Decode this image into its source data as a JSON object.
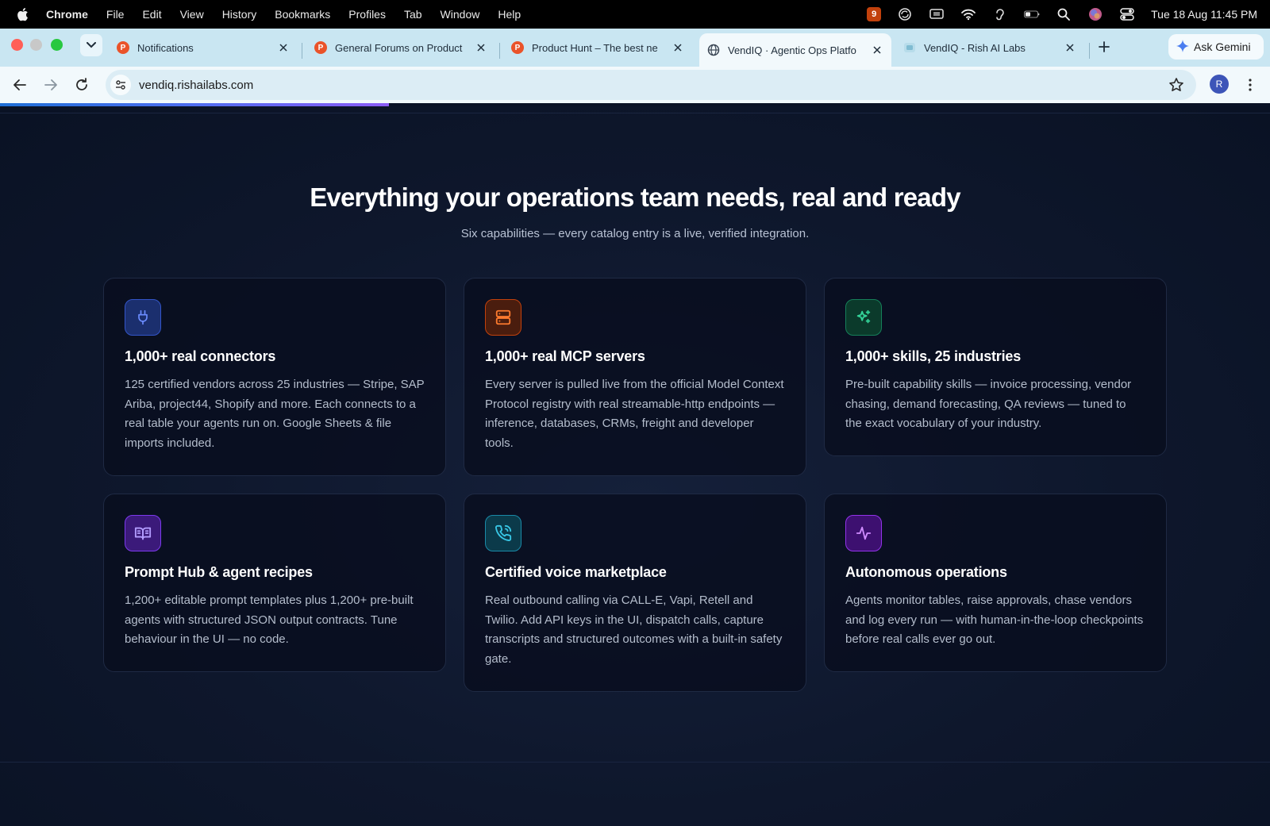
{
  "menubar": {
    "app_name": "Chrome",
    "menus": [
      "File",
      "Edit",
      "View",
      "History",
      "Bookmarks",
      "Profiles",
      "Tab",
      "Window",
      "Help"
    ],
    "badge_count": "9",
    "clock": "Tue 18 Aug  11:45 PM"
  },
  "tabs": [
    {
      "title": "Notifications",
      "icon": "product-hunt-icon"
    },
    {
      "title": "General Forums on Product",
      "icon": "product-hunt-icon"
    },
    {
      "title": "Product Hunt – The best ne",
      "icon": "product-hunt-icon"
    },
    {
      "title": "VendIQ · Agentic Ops Platfo",
      "icon": "globe-icon",
      "active": true
    },
    {
      "title": "VendIQ - Rish AI Labs",
      "icon": "vendiq-favicon-icon"
    }
  ],
  "gemini": {
    "label": "Ask Gemini"
  },
  "toolbar": {
    "url": "vendiq.rishailabs.com",
    "profile_initial": "R"
  },
  "section": {
    "title": "Everything your operations team needs, real and ready",
    "subtitle": "Six capabilities — every catalog entry is a live, verified integration."
  },
  "cards": [
    {
      "icon": "plug-icon",
      "accent": "#3b6cf6",
      "title": "1,000+ real connectors",
      "description": "125 certified vendors across 25 industries — Stripe, SAP Ariba, project44, Shopify and more. Each connects to a real table your agents run on. Google Sheets & file imports included."
    },
    {
      "icon": "server-icon",
      "accent": "#f97316",
      "title": "1,000+ real MCP servers",
      "description": "Every server is pulled live from the official Model Context Protocol registry with real streamable-http endpoints — inference, databases, CRMs, freight and developer tools."
    },
    {
      "icon": "sparkles-icon",
      "accent": "#22c55e",
      "title": "1,000+ skills, 25 industries",
      "description": "Pre-built capability skills — invoice processing, vendor chasing, demand forecasting, QA reviews — tuned to the exact vocabulary of your industry."
    },
    {
      "icon": "book-open-icon",
      "accent": "#a78bfa",
      "title": "Prompt Hub & agent recipes",
      "description": "1,200+ editable prompt templates plus 1,200+ pre-built agents with structured JSON output contracts. Tune behaviour in the UI — no code."
    },
    {
      "icon": "phone-call-icon",
      "accent": "#22b8d6",
      "title": "Certified voice marketplace",
      "description": "Real outbound calling via CALL-E, Vapi, Retell and Twilio. Add API keys in the UI, dispatch calls, capture transcripts and structured outcomes with a built-in safety gate."
    },
    {
      "icon": "activity-icon",
      "accent": "#c084fc",
      "title": "Autonomous operations",
      "description": "Agents monitor tables, raise approvals, chase vendors and log every run — with human-in-the-loop checkpoints before real calls ever go out."
    }
  ]
}
